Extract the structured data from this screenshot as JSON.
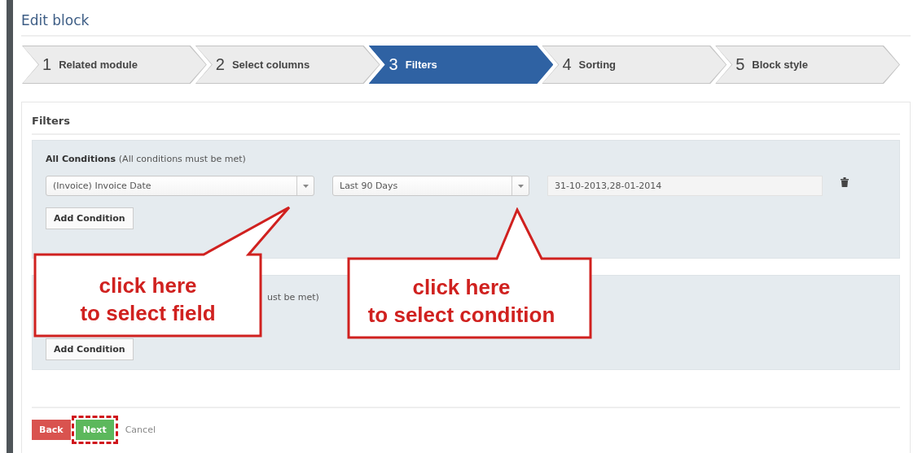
{
  "title": "Edit block",
  "steps": [
    {
      "number": "1",
      "label": "Related module",
      "selected": false
    },
    {
      "number": "2",
      "label": "Select columns",
      "selected": false
    },
    {
      "number": "3",
      "label": "Filters",
      "selected": true
    },
    {
      "number": "4",
      "label": "Sorting",
      "selected": false
    },
    {
      "number": "5",
      "label": "Block style",
      "selected": false
    }
  ],
  "section_title": "Filters",
  "groups": [
    {
      "title": "All Conditions",
      "note": "(All conditions must be met)",
      "condition": {
        "field": "(Invoice) Invoice Date",
        "operator": "Last 90 Days",
        "value": "31-10-2013,28-01-2014"
      },
      "add_button": "Add Condition"
    },
    {
      "note": "ust be met)",
      "add_button": "Add Condition"
    }
  ],
  "callouts": [
    {
      "lines": [
        "click here",
        "to select field"
      ]
    },
    {
      "lines": [
        "click here",
        "to select condition"
      ]
    }
  ],
  "footer": {
    "back": "Back",
    "next": {
      "label": "Next",
      "highlighted": true
    },
    "cancel": "Cancel"
  }
}
